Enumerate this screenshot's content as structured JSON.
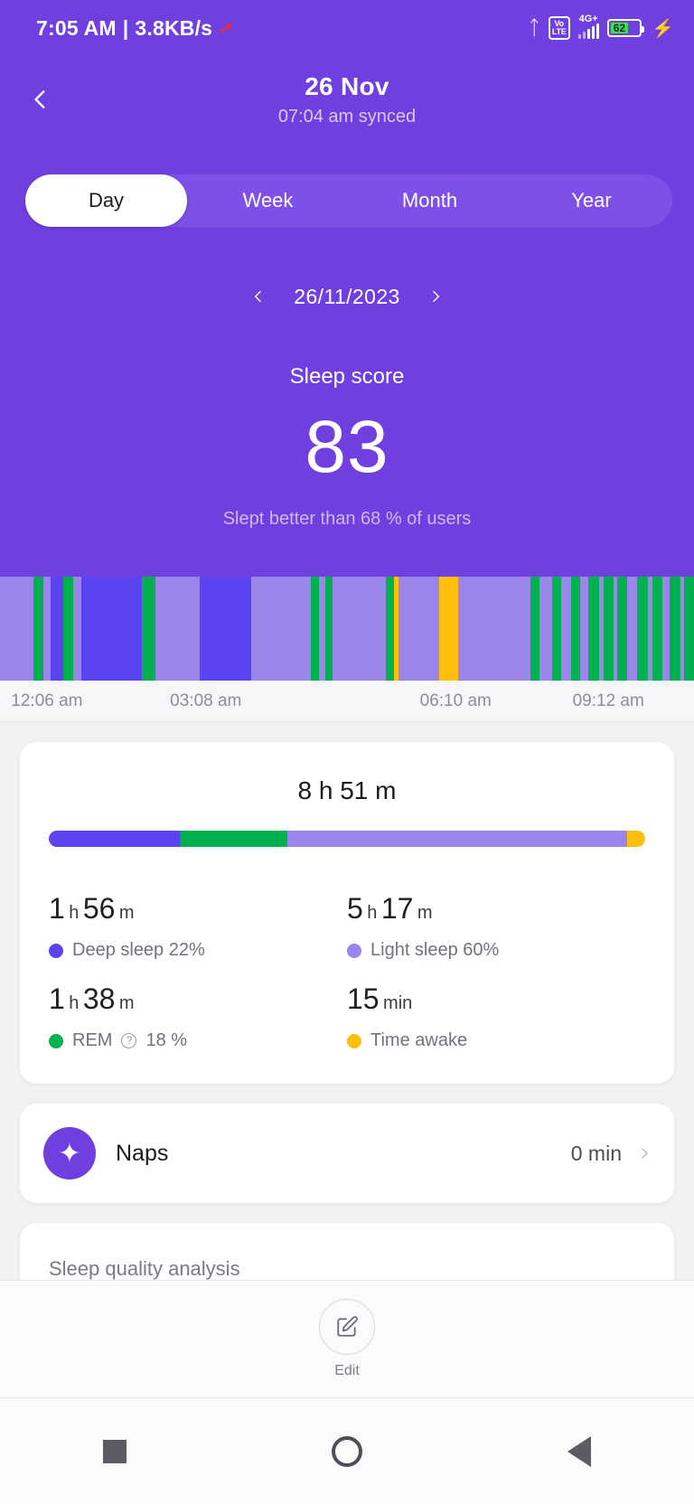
{
  "status_bar": {
    "time": "7:05 AM",
    "separator": "|",
    "net_speed": "3.8KB/s",
    "speed_icon": "arrow-up-red-icon",
    "bluetooth_icon": "bluetooth-icon",
    "volte_line1": "Vo",
    "volte_line2": "LTE",
    "network_type": "4G+",
    "battery_percent": "62",
    "charging_icon": "lightning-bolt-icon"
  },
  "header": {
    "back_icon": "chevron-left-icon",
    "title": "26 Nov",
    "subtitle": "07:04 am synced",
    "tabs": [
      {
        "label": "Day",
        "active": true
      },
      {
        "label": "Week",
        "active": false
      },
      {
        "label": "Month",
        "active": false
      },
      {
        "label": "Year",
        "active": false
      }
    ],
    "date_nav": {
      "prev_icon": "chevron-left-icon",
      "date": "26/11/2023",
      "next_icon": "chevron-right-icon"
    },
    "score_label": "Sleep score",
    "score_value": "83",
    "score_sub": "Slept better than 68 % of users"
  },
  "colors": {
    "brand_purple": "#6f3fe0",
    "tab_track": "#7d51e8",
    "deep_sleep": "#5b43ef",
    "light_sleep": "#9a85ea",
    "rem": "#00b14f",
    "awake": "#ffbe0b",
    "card_bg": "#ffffff",
    "page_bg": "#f2f2f4"
  },
  "chart_data": {
    "type": "bar",
    "title": "Sleep stages hypnogram",
    "xlabel": "",
    "ylabel": "",
    "grid": false,
    "legend_position": "below",
    "x_tick_labels": [
      "12:06 am",
      "03:08 am",
      "06:10 am",
      "09:12 am"
    ],
    "x_tick_positions_pct": [
      1.6,
      24.5,
      60.5,
      82.5
    ],
    "stage_colors": {
      "deep": "#5b43ef",
      "light": "#9a85ea",
      "rem": "#00b14f",
      "awake": "#ffbe0b"
    },
    "segments": [
      {
        "stage": "light",
        "width_pct": 5.2
      },
      {
        "stage": "rem",
        "width_pct": 1.6
      },
      {
        "stage": "light",
        "width_pct": 1.2
      },
      {
        "stage": "deep",
        "width_pct": 2.0
      },
      {
        "stage": "rem",
        "width_pct": 1.6
      },
      {
        "stage": "light",
        "width_pct": 1.2
      },
      {
        "stage": "deep",
        "width_pct": 9.6
      },
      {
        "stage": "rem",
        "width_pct": 2.1
      },
      {
        "stage": "light",
        "width_pct": 7.0
      },
      {
        "stage": "deep",
        "width_pct": 8.0
      },
      {
        "stage": "light",
        "width_pct": 9.5
      },
      {
        "stage": "rem",
        "width_pct": 1.3
      },
      {
        "stage": "light",
        "width_pct": 0.9
      },
      {
        "stage": "rem",
        "width_pct": 1.1
      },
      {
        "stage": "light",
        "width_pct": 8.5
      },
      {
        "stage": "rem",
        "width_pct": 1.2
      },
      {
        "stage": "awake",
        "width_pct": 0.7
      },
      {
        "stage": "light",
        "width_pct": 6.4
      },
      {
        "stage": "awake",
        "width_pct": 3.1
      },
      {
        "stage": "light",
        "width_pct": 11.3
      },
      {
        "stage": "rem",
        "width_pct": 1.5
      },
      {
        "stage": "light",
        "width_pct": 2.0
      },
      {
        "stage": "rem",
        "width_pct": 1.4
      },
      {
        "stage": "light",
        "width_pct": 1.5
      },
      {
        "stage": "rem",
        "width_pct": 1.5
      },
      {
        "stage": "light",
        "width_pct": 1.3
      },
      {
        "stage": "rem",
        "width_pct": 1.6
      },
      {
        "stage": "light",
        "width_pct": 0.7
      },
      {
        "stage": "rem",
        "width_pct": 1.6
      },
      {
        "stage": "light",
        "width_pct": 0.6
      },
      {
        "stage": "rem",
        "width_pct": 1.6
      },
      {
        "stage": "light",
        "width_pct": 1.6
      },
      {
        "stage": "rem",
        "width_pct": 1.7
      },
      {
        "stage": "light",
        "width_pct": 0.6
      },
      {
        "stage": "rem",
        "width_pct": 1.6
      },
      {
        "stage": "light",
        "width_pct": 1.2
      },
      {
        "stage": "rem",
        "width_pct": 1.6
      },
      {
        "stage": "light",
        "width_pct": 0.6
      },
      {
        "stage": "rem",
        "width_pct": 1.6
      }
    ]
  },
  "summary_card": {
    "total_duration": "8 h 51 m",
    "stack": [
      {
        "stage": "deep",
        "pct": 22
      },
      {
        "stage": "rem",
        "pct": 18
      },
      {
        "stage": "light",
        "pct": 57
      },
      {
        "stage": "awake",
        "pct": 3
      }
    ],
    "stats": [
      {
        "num1": "1",
        "unit1": "h",
        "num2": "56",
        "unit2": "m",
        "legend": "Deep sleep 22%",
        "dot_color": "#5b43ef",
        "has_info": false
      },
      {
        "num1": "5",
        "unit1": "h",
        "num2": "17",
        "unit2": "m",
        "legend": "Light sleep 60%",
        "dot_color": "#9a85ea",
        "has_info": false
      },
      {
        "num1": "1",
        "unit1": "h",
        "num2": "38",
        "unit2": "m",
        "legend_pre": "REM",
        "legend_post": "18 %",
        "dot_color": "#00b14f",
        "has_info": true
      },
      {
        "num1": "15",
        "unit1": "min",
        "num2": "",
        "unit2": "",
        "legend": "Time awake",
        "dot_color": "#ffbe0b",
        "has_info": false
      }
    ]
  },
  "naps_card": {
    "icon": "sparkle-star-icon",
    "label": "Naps",
    "value": "0 min",
    "chevron": "chevron-right-icon"
  },
  "analysis_card": {
    "title": "Sleep quality analysis"
  },
  "edit_bar": {
    "icon": "edit-square-pencil-icon",
    "label": "Edit"
  },
  "nav_bar": {
    "recents": "square-recents-icon",
    "home": "circle-home-icon",
    "back": "triangle-back-icon"
  }
}
